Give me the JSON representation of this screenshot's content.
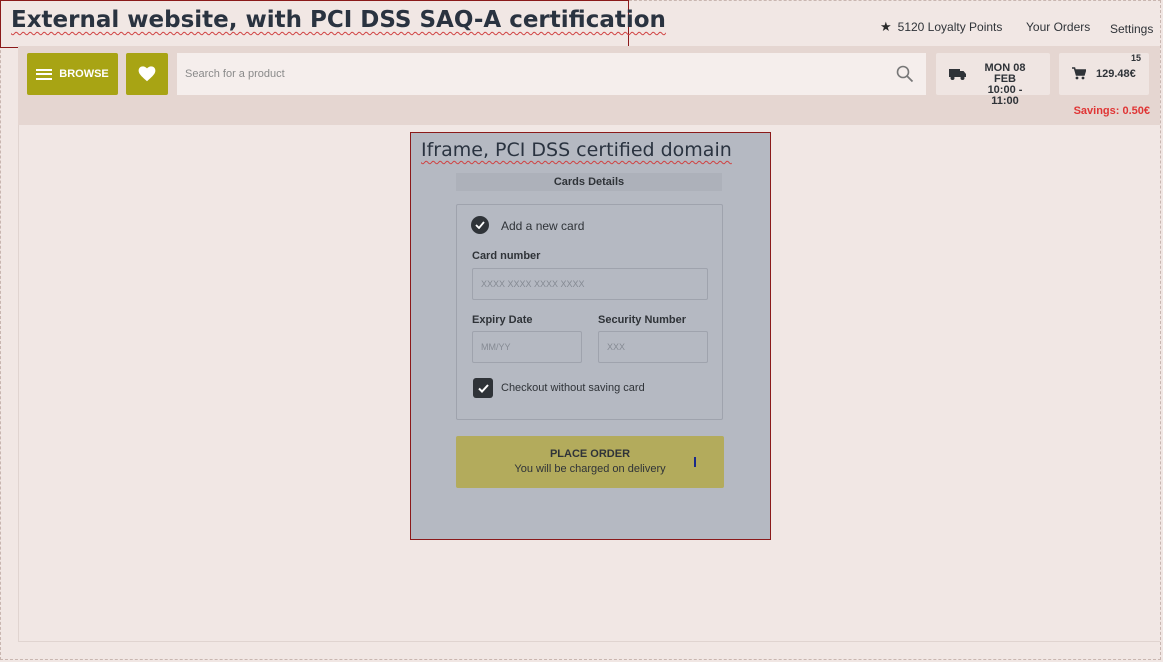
{
  "annotations": {
    "external_title": "External website, with PCI DSS SAQ-A certification",
    "iframe_title": "Iframe, PCI DSS certified domain"
  },
  "header": {
    "loyalty_points": "5120 Loyalty Points",
    "orders_link": "Your Orders",
    "settings_link": "Settings"
  },
  "navbar": {
    "browse_label": "BROWSE",
    "search_placeholder": "Search for a product",
    "delivery_day": "MON 08 FEB",
    "delivery_time": "10:00 - 11:00",
    "cart_total": "129.48€",
    "cart_count": "15",
    "savings": "Savings: 0.50€"
  },
  "payment_form": {
    "section_title": "Cards Details",
    "add_card_label": "Add a new card",
    "card_number_label": "Card number",
    "card_number_placeholder": "XXXX XXXX XXXX XXXX",
    "expiry_label": "Expiry Date",
    "expiry_placeholder": "MM/YY",
    "security_label": "Security Number",
    "security_placeholder": "XXX",
    "checkout_without_saving": "Checkout without saving card",
    "place_order_label": "PLACE ORDER",
    "place_order_sub": "You will be charged on delivery"
  },
  "colors": {
    "accent": "#a8a414",
    "savings": "#e03535",
    "annotation_border": "#8b1a1a"
  },
  "icons": [
    "star-icon",
    "menu-icon",
    "heart-icon",
    "search-icon",
    "truck-icon",
    "cart-icon",
    "check-icon"
  ]
}
